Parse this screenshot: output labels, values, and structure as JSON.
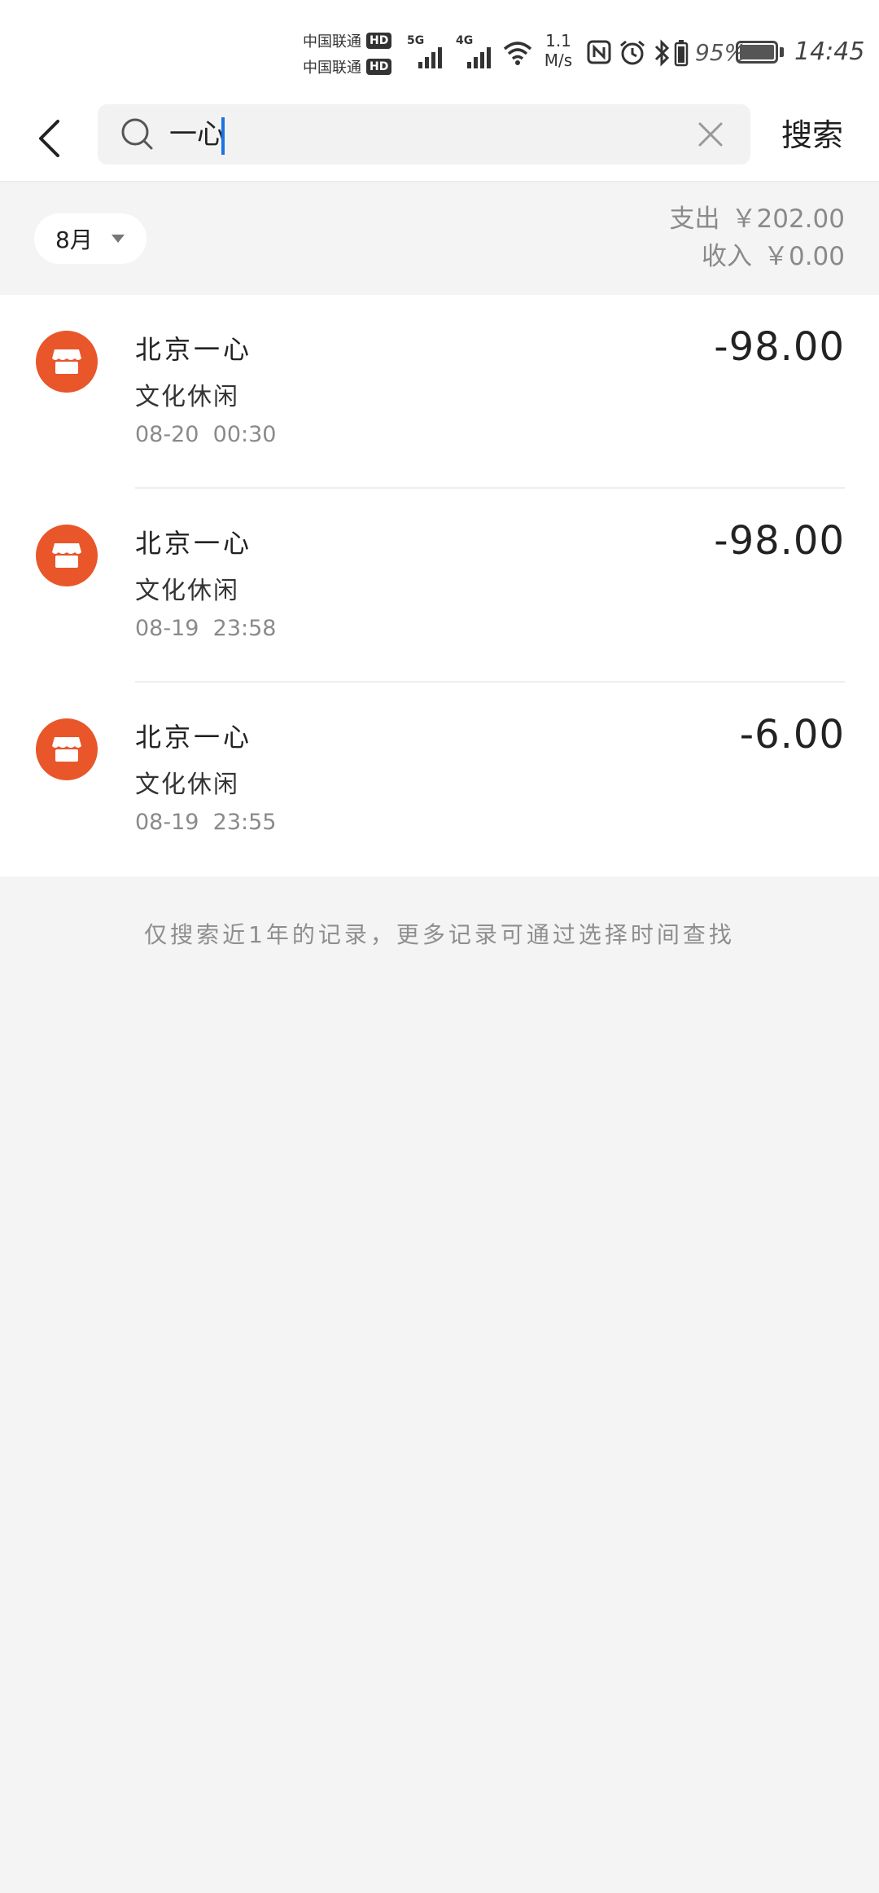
{
  "status_bar": {
    "carrier_1": "中国联通",
    "carrier_2": "中国联通",
    "hd_badge": "HD",
    "signal_1_label": "5G",
    "signal_2_label": "4G",
    "net_speed_value": "1.1",
    "net_speed_unit": "M/s",
    "battery_percent": "95%",
    "time": "14:45"
  },
  "search": {
    "query": "一心",
    "submit_label": "搜索"
  },
  "summary": {
    "month": "8月",
    "expense_label": "支出",
    "expense_value": "￥202.00",
    "income_label": "收入",
    "income_value": "￥0.00"
  },
  "transactions": [
    {
      "name": "北京一心",
      "category": "文化休闲",
      "date": "08-20",
      "time": "00:30",
      "amount": "-98.00"
    },
    {
      "name": "北京一心",
      "category": "文化休闲",
      "date": "08-19",
      "time": "23:58",
      "amount": "-98.00"
    },
    {
      "name": "北京一心",
      "category": "文化休闲",
      "date": "08-19",
      "time": "23:55",
      "amount": "-6.00"
    }
  ],
  "footer_hint": "仅搜索近1年的记录，更多记录可通过选择时间查找",
  "colors": {
    "merchant_icon": "#e8562a",
    "caret": "#1a73e8",
    "muted_text": "#8a8a8a"
  },
  "icons": {
    "back": "chevron-left-icon",
    "search": "search-icon",
    "clear": "close-icon",
    "month_dropdown": "caret-down-icon",
    "merchant": "store-icon"
  }
}
